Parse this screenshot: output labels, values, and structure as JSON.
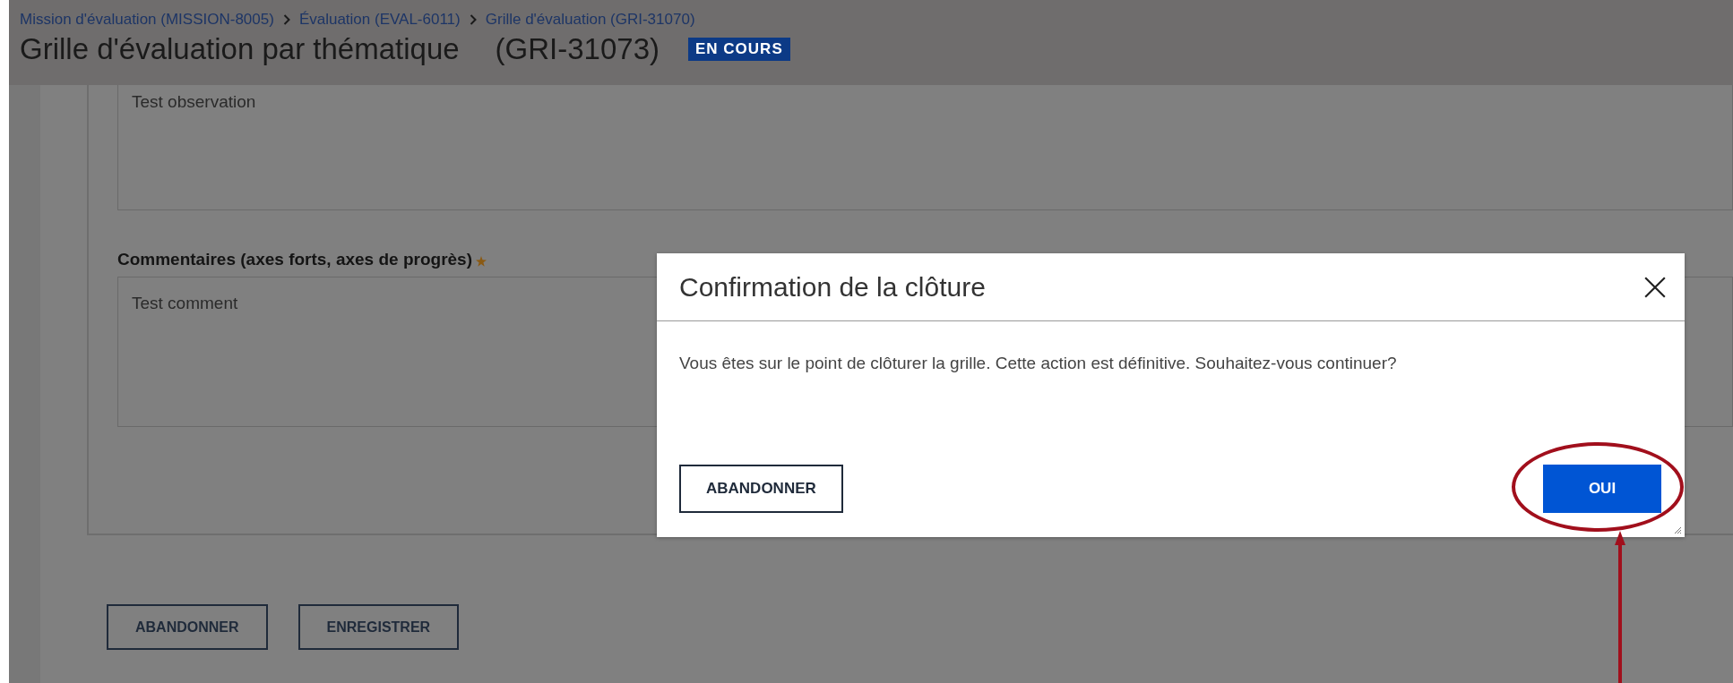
{
  "header": {
    "breadcrumbs": [
      {
        "label": "Mission d'évaluation (MISSION-8005)"
      },
      {
        "label": "Évaluation (EVAL-6011)"
      },
      {
        "label": "Grille d'évaluation (GRI-31070)"
      }
    ],
    "title": "Grille d'évaluation par thématique",
    "code": "(GRI-31073)",
    "status": "EN COURS"
  },
  "form": {
    "fields": [
      {
        "value": "Test observation"
      },
      {
        "label": "Commentaires (axes forts, axes de progrès)",
        "value": "Test comment",
        "required": true
      }
    ],
    "buttons": [
      "ABANDONNER",
      "ENREGISTRER"
    ]
  },
  "dialog": {
    "title": "Confirmation de la clôture",
    "message": "Vous êtes sur le point de clôturer la grille. Cette action est définitive. Souhaitez-vous continuer?",
    "buttons": [
      {
        "label": "ABANDONNER",
        "kind": "secondary",
        "highlighted": false
      },
      {
        "label": "OUI",
        "kind": "primary",
        "highlighted": true
      }
    ]
  }
}
